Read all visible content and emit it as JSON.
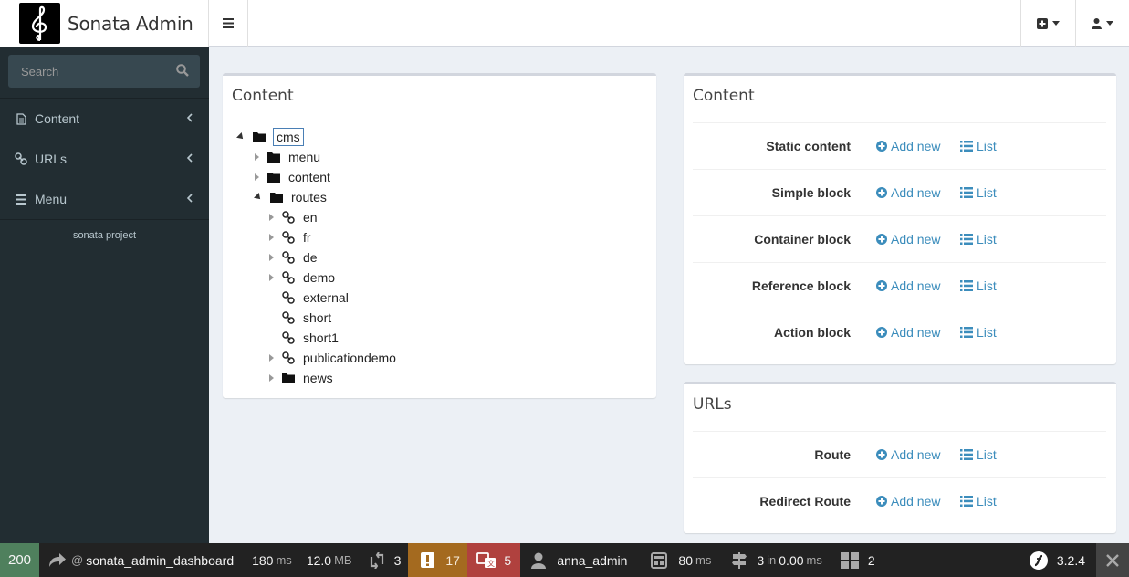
{
  "app": {
    "title": "Sonata Admin"
  },
  "search": {
    "placeholder": "Search"
  },
  "sidebar": {
    "items": [
      {
        "label": "Content"
      },
      {
        "label": "URLs"
      },
      {
        "label": "Menu"
      }
    ],
    "footer": "sonata project"
  },
  "tree_box": {
    "title": "Content",
    "root": "cms",
    "nodes": [
      "menu",
      "content",
      "routes",
      "en",
      "fr",
      "de",
      "demo",
      "external",
      "short",
      "short1",
      "publicationdemo",
      "news"
    ]
  },
  "content_box": {
    "title": "Content",
    "rows": [
      {
        "label": "Static content"
      },
      {
        "label": "Simple block"
      },
      {
        "label": "Container block"
      },
      {
        "label": "Reference block"
      },
      {
        "label": "Action block"
      }
    ]
  },
  "urls_box": {
    "title": "URLs",
    "rows": [
      {
        "label": "Route"
      },
      {
        "label": "Redirect Route"
      }
    ]
  },
  "actions": {
    "add_new": "Add new",
    "list": "List"
  },
  "toolbar": {
    "status": "200",
    "route_prefix": "@",
    "route": "sonata_admin_dashboard",
    "time_value": "180",
    "time_unit": "ms",
    "memory_value": "12.0",
    "memory_unit": "MB",
    "forms": "3",
    "logs": "17",
    "translations": "5",
    "user": "anna_admin",
    "twig_value": "80",
    "twig_unit": "ms",
    "db_queries": "3",
    "db_in": "in",
    "db_time": "0.00",
    "db_unit": "ms",
    "blocks": "2",
    "version": "3.2.4"
  },
  "colors": {
    "status_ok": "#4f805d",
    "logs_warning": "#a46a1f",
    "translations_error": "#b0413e",
    "link": "#3c8dbc",
    "sidebar_bg": "#222d32"
  }
}
